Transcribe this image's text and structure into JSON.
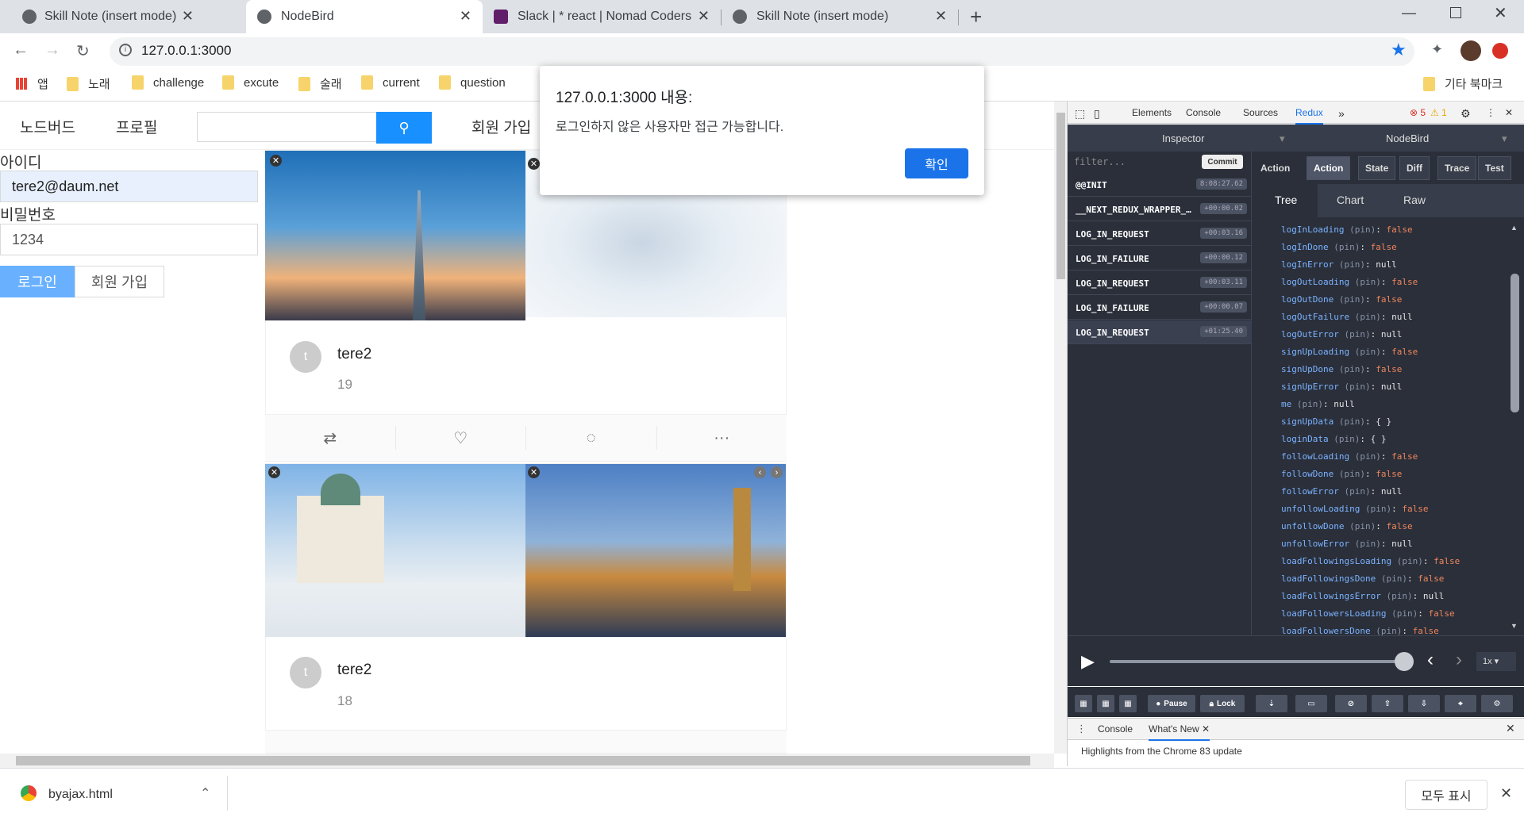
{
  "tabs": [
    {
      "title": "Skill Note (insert mode)"
    },
    {
      "title": "NodeBird"
    },
    {
      "title": "Slack | * react | Nomad Coders"
    },
    {
      "title": "Skill Note (insert mode)"
    }
  ],
  "address": {
    "url": "127.0.0.1:3000"
  },
  "bookmarks": {
    "apps": "앱",
    "items": [
      "노래",
      "challenge",
      "excute",
      "술래",
      "current",
      "question"
    ],
    "other": "기타 북마크"
  },
  "page": {
    "nav": {
      "home": "노드버드",
      "profile": "프로필",
      "signup": "회원 가입"
    },
    "login": {
      "id_label": "아이디",
      "id_value": "tere2@daum.net",
      "pw_label": "비밀번호",
      "pw_value": "1234",
      "login_btn": "로그인",
      "signup_btn": "회원 가입"
    },
    "posts": [
      {
        "avatar": "t",
        "user": "tere2",
        "content": "19"
      },
      {
        "avatar": "t",
        "user": "tere2",
        "content": "18"
      }
    ]
  },
  "alert": {
    "title": "127.0.0.1:3000 내용:",
    "message": "로그인하지 않은 사용자만 접근 가능합니다.",
    "ok": "확인"
  },
  "devtools": {
    "tabs": [
      "Elements",
      "Console",
      "Sources",
      "Redux"
    ],
    "errors": "5",
    "warnings": "1",
    "inspector": "Inspector",
    "instance": "NodeBird",
    "filter_placeholder": "filter...",
    "commit": "Commit",
    "actions": [
      {
        "name": "@@INIT",
        "time": "8:08:27.62"
      },
      {
        "name": "__NEXT_REDUX_WRAPPER_…",
        "time": "+00:00.02"
      },
      {
        "name": "LOG_IN_REQUEST",
        "time": "+00:03.16"
      },
      {
        "name": "LOG_IN_FAILURE",
        "time": "+00:00.12"
      },
      {
        "name": "LOG_IN_REQUEST",
        "time": "+00:03.11"
      },
      {
        "name": "LOG_IN_FAILURE",
        "time": "+00:00.07"
      },
      {
        "name": "LOG_IN_REQUEST",
        "time": "+01:25.40"
      }
    ],
    "state_tabs": [
      "Action",
      "Action",
      "State",
      "Diff",
      "Trace",
      "Test"
    ],
    "view_tabs": [
      "Tree",
      "Chart",
      "Raw"
    ],
    "state": [
      {
        "k": "logInLoading",
        "v": "false"
      },
      {
        "k": "logInDone",
        "v": "false"
      },
      {
        "k": "logInError",
        "v": "null"
      },
      {
        "k": "logOutLoading",
        "v": "false"
      },
      {
        "k": "logOutDone",
        "v": "false"
      },
      {
        "k": "logOutFailure",
        "v": "null"
      },
      {
        "k": "logOutError",
        "v": "null"
      },
      {
        "k": "signUpLoading",
        "v": "false"
      },
      {
        "k": "signUpDone",
        "v": "false"
      },
      {
        "k": "signUpError",
        "v": "null"
      },
      {
        "k": "me",
        "v": "null"
      },
      {
        "k": "signUpData",
        "v": "{ }"
      },
      {
        "k": "loginData",
        "v": "{ }"
      },
      {
        "k": "followLoading",
        "v": "false"
      },
      {
        "k": "followDone",
        "v": "false"
      },
      {
        "k": "followError",
        "v": "null"
      },
      {
        "k": "unfollowLoading",
        "v": "false"
      },
      {
        "k": "unfollowDone",
        "v": "false"
      },
      {
        "k": "unfollowError",
        "v": "null"
      },
      {
        "k": "loadFollowingsLoading",
        "v": "false"
      },
      {
        "k": "loadFollowingsDone",
        "v": "false"
      },
      {
        "k": "loadFollowingsError",
        "v": "null"
      },
      {
        "k": "loadFollowersLoading",
        "v": "false"
      },
      {
        "k": "loadFollowersDone",
        "v": "false"
      }
    ],
    "pin": "(pin)",
    "speed": "1x",
    "buttons": {
      "pause": "Pause",
      "lock": "Lock"
    },
    "drawer": {
      "console": "Console",
      "whatsnew": "What's New",
      "content": "Highlights from the Chrome 83 update"
    }
  },
  "download": {
    "file": "byajax.html",
    "show_all": "모두 표시"
  }
}
